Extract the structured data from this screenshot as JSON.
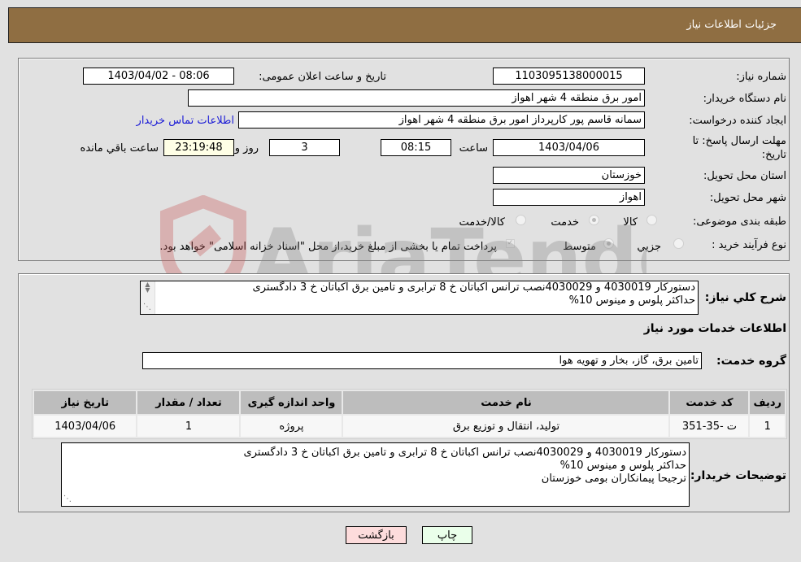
{
  "header": {
    "title": "جزئیات اطلاعات نیاز"
  },
  "details": {
    "need_number_label": "شماره نیاز:",
    "need_number": "1103095138000015",
    "announce_label": "تاریخ و ساعت اعلان عمومی:",
    "announce_value": "1403/04/02 - 08:06",
    "buyer_org_label": "نام دستگاه خریدار:",
    "buyer_org": "امور برق منطقه 4 شهر اهواز",
    "creator_label": "ایجاد کننده درخواست:",
    "creator": "سمانه قاسم پور کارپرداز امور برق منطقه 4 شهر اهواز",
    "contact_link": "اطلاعات تماس خریدار",
    "deadline_label_line1": "مهلت ارسال پاسخ: تا",
    "deadline_label_line2": "تاریخ:",
    "deadline_date": "1403/04/06",
    "time_label": "ساعت",
    "deadline_time": "08:15",
    "days_value": "3",
    "days_label": "روز و",
    "remaining_time": "23:19:48",
    "remaining_label": "ساعت باقي مانده",
    "province_label": "استان محل تحویل:",
    "province": "خوزستان",
    "city_label": "شهر محل تحویل:",
    "city": "اهواز",
    "category_label": "طبقه بندی موضوعی:",
    "category_options": [
      {
        "label": "کالا",
        "checked": false
      },
      {
        "label": "خدمت",
        "checked": true
      },
      {
        "label": "کالا/خدمت",
        "checked": false
      }
    ],
    "process_label": "نوع فرآیند خرید :",
    "process_options": [
      {
        "label": "جزيي",
        "checked": false
      },
      {
        "label": "متوسط",
        "checked": true
      }
    ],
    "treasury_checkbox_label": "پرداخت تمام یا بخشی از مبلغ خرید،از محل \"اسناد خزانه اسلامی\" خواهد بود.",
    "treasury_checked": true
  },
  "services": {
    "description_label": "شرح کلي نیاز:",
    "description": "دستورکار 4030019 و 4030029نصب ترانس اکباتان خ 8 ترابری و تامین برق اکباتان خ 3 دادگستری\nحداکثر پلوس و مینوس 10%",
    "section_title": "اطلاعات خدمات مورد نیاز",
    "group_label": "گروه خدمت:",
    "group_value": "تامین برق، گاز، بخار و تهویه هوا",
    "table": {
      "headers": [
        "ردیف",
        "کد خدمت",
        "نام خدمت",
        "واحد اندازه گیری",
        "تعداد / مقدار",
        "تاریخ نیاز"
      ],
      "rows": [
        [
          "1",
          "ت -35-351",
          "تولید، انتقال و توزیع برق",
          "پروژه",
          "1",
          "1403/04/06"
        ]
      ]
    },
    "buyer_notes_label": "توضیحات خریدار:",
    "buyer_notes": "دستورکار 4030019 و 4030029نصب ترانس اکباتان خ 8 ترابری و تامین برق اکباتان خ 3 دادگستری\nحداکثر پلوس و مینوس 10%\nترجیحا پیمانکاران بومی خوزستان"
  },
  "buttons": {
    "print": "چاپ",
    "back": "بازگشت"
  },
  "watermark": {
    "text": "AriaTender.neT"
  }
}
